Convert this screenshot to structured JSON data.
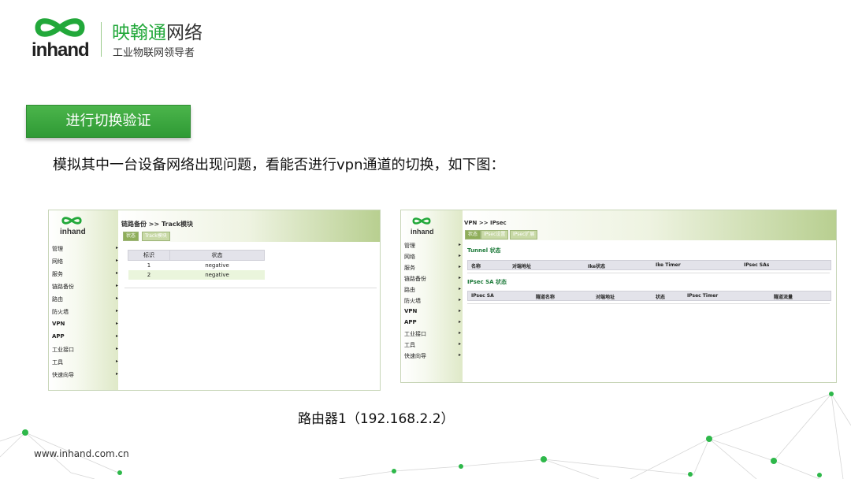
{
  "brand": {
    "logo_text": "inhand",
    "name_green": "映翰通",
    "name_gray": "网络",
    "slogan": "工业物联网领导者"
  },
  "section": {
    "label": "进行切换验证"
  },
  "description": "模拟其中一台设备网络出现问题，看能否进行vpn通道的切换，如下图：",
  "shot1": {
    "logo_text": "inhand",
    "breadcrumb": "链路备份 >> Track模块",
    "tabs": [
      {
        "label": "状态",
        "active": true
      },
      {
        "label": "Track模块",
        "active": false
      }
    ],
    "menu": [
      "管理",
      "网络",
      "服务",
      "链路备份",
      "路由",
      "防火墙",
      "VPN",
      "APP",
      "工业接口",
      "工具",
      "快速向导"
    ],
    "table": {
      "headers": [
        "标识",
        "状态"
      ],
      "rows": [
        [
          "1",
          "negative"
        ],
        [
          "2",
          "negative"
        ]
      ]
    }
  },
  "shot2": {
    "logo_text": "inhand",
    "breadcrumb": "VPN >> IPsec",
    "tabs": [
      {
        "label": "状态",
        "active": true
      },
      {
        "label": "IPsec设置",
        "active": false
      },
      {
        "label": "IPsec扩展",
        "active": false
      }
    ],
    "menu": [
      "管理",
      "网络",
      "服务",
      "链路备份",
      "路由",
      "防火墙",
      "VPN",
      "APP",
      "工业接口",
      "工具",
      "快速向导"
    ],
    "tunnel": {
      "title": "Tunnel 状态",
      "headers": [
        "名称",
        "对端地址",
        "Ike状态",
        "Ike Timer",
        "IPsec SAs"
      ]
    },
    "sa": {
      "title": "IPsec SA 状态",
      "headers": [
        "IPsec SA",
        "隧道名称",
        "对端地址",
        "状态",
        "IPsec Timer",
        "隧道流量"
      ]
    }
  },
  "caption": "路由器1（192.168.2.2）",
  "website": "www.inhand.com.cn",
  "colors": {
    "brand_green": "#22a83a",
    "button_green": "#3aa83f",
    "panel_green": "#b8cf90",
    "deco_dot": "#2eb84a"
  }
}
